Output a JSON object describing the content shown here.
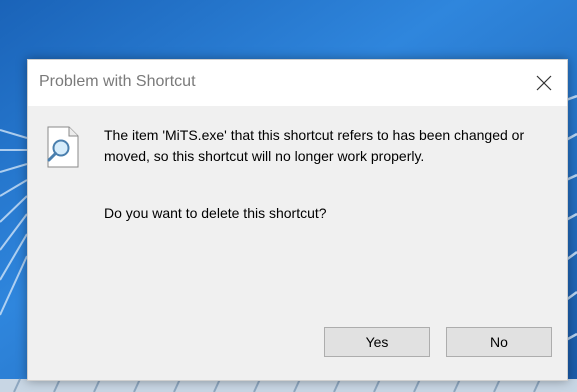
{
  "dialog": {
    "title": "Problem with Shortcut",
    "close_icon": "close-icon",
    "message_icon": "document-search-icon",
    "message": "The item 'MiTS.exe' that this shortcut refers to has been changed or moved, so this shortcut will no longer work properly.",
    "question": "Do you want to delete this shortcut?",
    "yes_label": "Yes",
    "no_label": "No"
  },
  "colors": {
    "desktop_blue": "#1e6fc6",
    "dialog_bg": "#f0f0f0",
    "titlebar_bg": "#ffffff",
    "button_bg": "#e1e1e1"
  }
}
